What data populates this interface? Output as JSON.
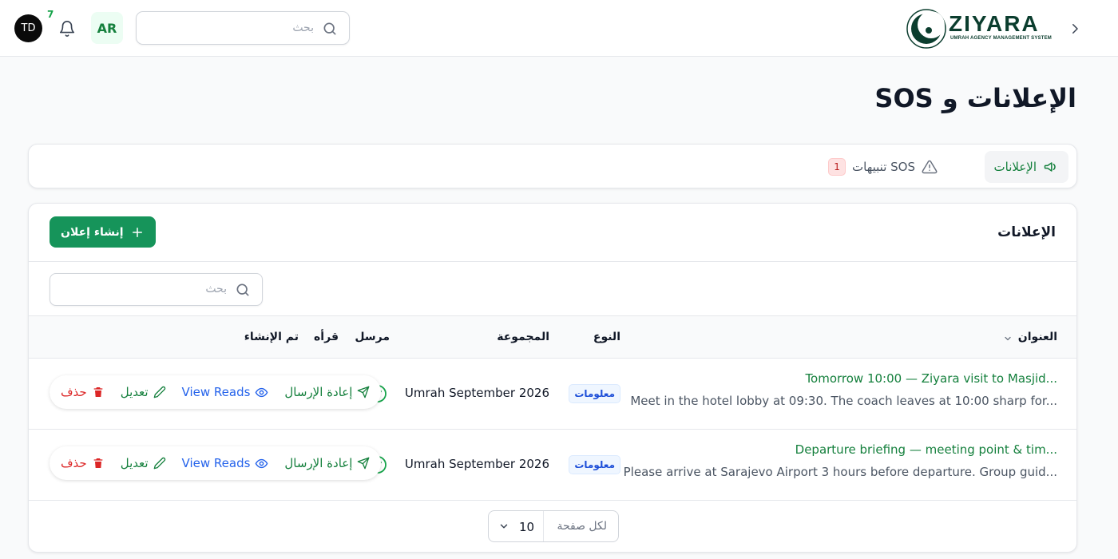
{
  "topbar": {
    "user_initials": "TD",
    "notifications_count": "7",
    "language": "AR",
    "search_placeholder": "بحث",
    "logo_word": "ZIYARA",
    "logo_subtitle": "UMRAH AGENCY MANAGEMENT SYSTEM",
    "icons": [
      "bell-icon",
      "search-icon",
      "chevron-right-icon"
    ]
  },
  "page": {
    "title": "الإعلانات و SOS"
  },
  "tabs": [
    {
      "label": "الإعلانات",
      "icon": "megaphone-icon",
      "active": true
    },
    {
      "label": "تنبيهات SOS",
      "icon": "warning-icon",
      "count": "1"
    }
  ],
  "announcements": {
    "section_title": "الإعلانات",
    "create_label": "إنشاء إعلان",
    "search_placeholder": "بحث",
    "columns": {
      "title": "العنوان",
      "type": "النوع",
      "group": "المجموعة",
      "sent": "مرسل",
      "reads": "قرأه",
      "created": "تم الإنشاء"
    },
    "rows": [
      {
        "title": "Tomorrow 10:00 — Ziyara visit to Masjid...",
        "subtitle": "Meet in the hotel lobby at 09:30. The coach leaves at 10:00 sharp for...",
        "type": "معلومات",
        "group": "Umrah September 2026",
        "sent": true
      },
      {
        "title": "Departure briefing — meeting point & tim...",
        "subtitle": "Please arrive at Sarajevo Airport 3 hours before departure. Group guid...",
        "type": "معلومات",
        "group": "Umrah September 2026",
        "sent": true
      }
    ],
    "actions": {
      "resend": "إعادة الإرسال",
      "view_reads": "View Reads",
      "edit": "تعديل",
      "delete": "حذف"
    },
    "pagination": {
      "per_page_label": "لكل صفحة",
      "per_page_value": "10"
    }
  },
  "colors": {
    "brand": "#16945a",
    "link": "#2563eb",
    "danger": "#dc2626"
  }
}
